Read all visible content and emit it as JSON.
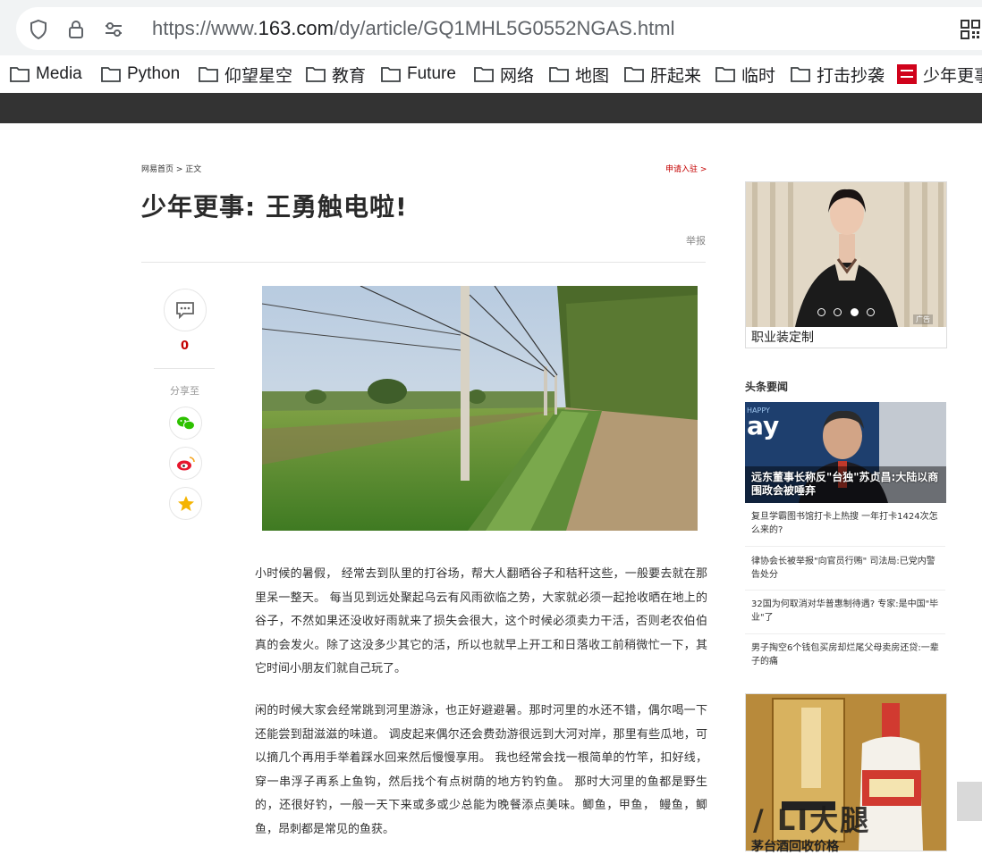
{
  "browser": {
    "url_prefix": "https://www.",
    "url_domain": "163.com",
    "url_path": "/dy/article/GQ1MHL5G0552NGAS.html",
    "icons": [
      "shield-icon",
      "lock-icon",
      "site-settings-icon",
      "qr-code-icon"
    ]
  },
  "bookmarks": [
    {
      "label": "Media"
    },
    {
      "label": "Python"
    },
    {
      "label": "仰望星空"
    },
    {
      "label": "教育"
    },
    {
      "label": "Future"
    },
    {
      "label": "网络"
    },
    {
      "label": "地图"
    },
    {
      "label": "肝起来"
    },
    {
      "label": "临时"
    },
    {
      "label": "打击抄袭"
    },
    {
      "label": "少年更事"
    }
  ],
  "article": {
    "breadcrumb": "网易首页 > 正文",
    "apply_link": "申请入驻 >",
    "title": "少年更事: 王勇触电啦!",
    "report": "举报",
    "comment_count": "0",
    "share_label": "分享至",
    "paragraphs": [
      "小时候的暑假， 经常去到队里的打谷场，帮大人翻晒谷子和秸秆这些，一般要去就在那里呆一整天。 每当见到远处聚起乌云有风雨欲临之势，大家就必须一起抢收晒在地上的谷子，不然如果还没收好雨就来了损失会很大，这个时候必须卖力干活，否则老农伯伯真的会发火。除了这没多少其它的活，所以也就早上开工和日落收工前稍微忙一下，其它时间小朋友们就自己玩了。",
      "闲的时候大家会经常跳到河里游泳，也正好避避暑。那时河里的水还不错，偶尔喝一下还能尝到甜滋滋的味道。 调皮起来偶尔还会费劲游很远到大河对岸，那里有些瓜地，可以摘几个再用手举着踩水回来然后慢慢享用。 我也经常会找一根简单的竹竿，扣好线， 穿一串浮子再系上鱼钩，然后找个有点树荫的地方钓钓鱼。 那时大河里的鱼都是野生的，还很好钓，一般一天下来或多或少总能为晚餐添点美味。鲫鱼，甲鱼， 鳗鱼，鲫鱼，昂刺都是常见的鱼获。"
    ]
  },
  "sidebar": {
    "ad1_label": "职业装定制",
    "ad1_tag": "广告",
    "hot_title": "头条要闻",
    "top_news_caption": "远东董事长称反\"台独\"苏贞昌:大陆以商围政会被唾弃",
    "news": [
      "复旦学霸图书馆打卡上热搜 一年打卡1424次怎么来的?",
      "律协会长被举报\"向官员行贿\" 司法局:已党内警告处分",
      "32国为何取消对华普惠制待遇? 专家:是中国\"毕业\"了",
      "男子掏空6个钱包买房却烂尾父母卖房还贷:一辈子的痛"
    ],
    "ad2_label": "茅台酒回收价格",
    "watermark": "/ LI大腿"
  },
  "colors": {
    "accent_red": "#c40000",
    "dark_band": "#333333"
  }
}
